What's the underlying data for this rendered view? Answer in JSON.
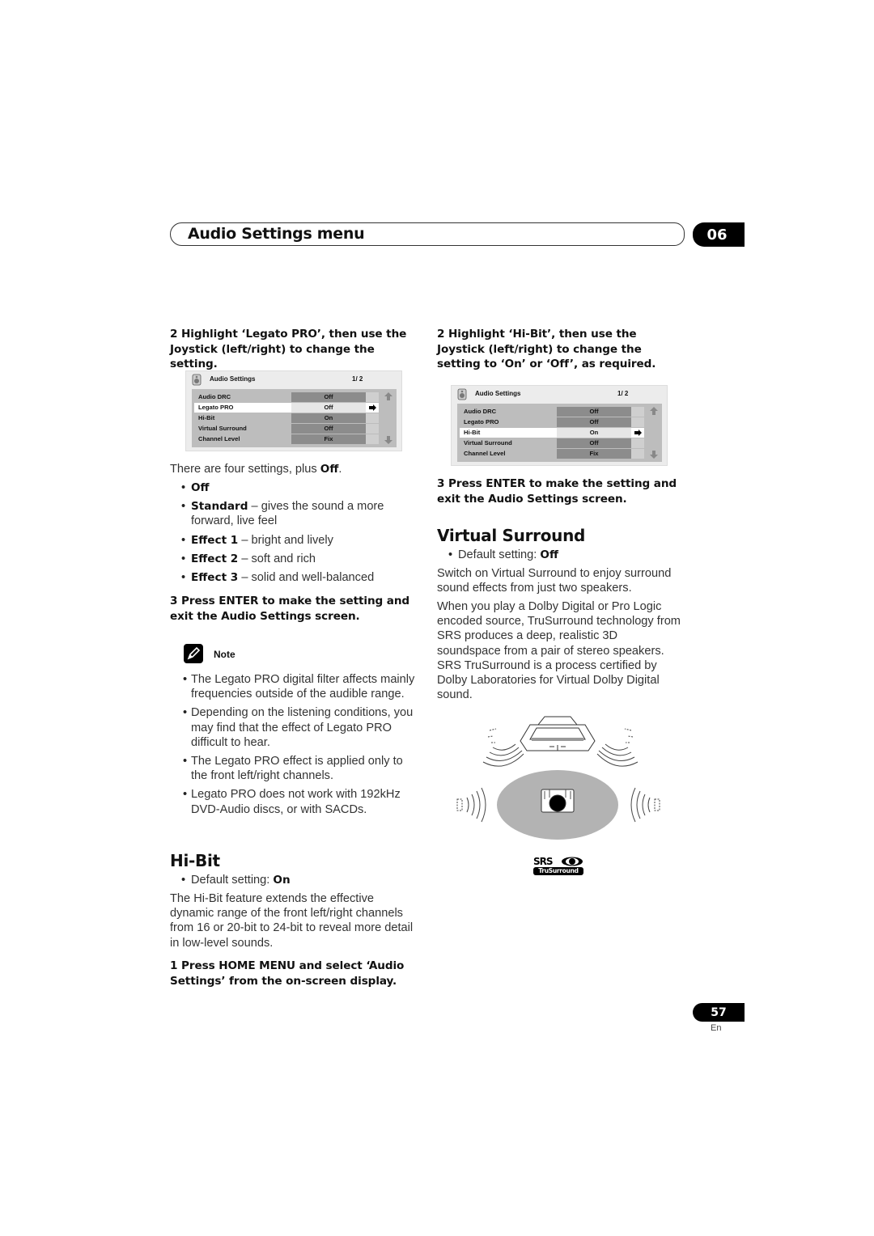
{
  "header": {
    "title": "Audio Settings menu",
    "chapter": "06"
  },
  "left": {
    "step2": "2   Highlight ‘Legato PRO’, then use the Joystick (left/right) to change the setting.",
    "osd": {
      "title": "Audio Settings",
      "page": "1/ 2",
      "selected": "Legato PRO",
      "rows": [
        {
          "label": "Audio DRC",
          "value": "Off"
        },
        {
          "label": "Legato PRO",
          "value": "Off"
        },
        {
          "label": "Hi-Bit",
          "value": "On"
        },
        {
          "label": "Virtual Surround",
          "value": "Off"
        },
        {
          "label": "Channel Level",
          "value": "Fix"
        }
      ]
    },
    "intro_pre": "There are four settings, plus ",
    "intro_bold": "Off",
    "intro_post": ".",
    "settings": [
      {
        "name": "Off",
        "desc": ""
      },
      {
        "name": "Standard",
        "desc": " – gives the sound a more forward, live feel"
      },
      {
        "name": "Effect 1",
        "desc": " – bright and lively"
      },
      {
        "name": "Effect 2",
        "desc": " – soft and rich"
      },
      {
        "name": "Effect 3",
        "desc": " – solid and well-balanced"
      }
    ],
    "step3": "3   Press ENTER to make the setting and exit the Audio Settings screen.",
    "note_label": "Note",
    "notes": [
      "The Legato PRO digital filter affects mainly frequencies outside of the audible range.",
      "Depending on the listening conditions, you may find that the effect of Legato PRO difficult to hear.",
      "The Legato PRO effect is applied only to the front left/right channels.",
      "Legato PRO does not work with 192kHz DVD-Audio discs, or with SACDs."
    ],
    "hibit": {
      "heading": "Hi-Bit",
      "default_label": "Default setting: ",
      "default_value": "On",
      "desc": "The Hi-Bit feature extends the effective dynamic range of the front left/right channels from 16 or 20-bit to 24-bit to reveal more detail in low-level sounds.",
      "step1": "1   Press HOME MENU and select ‘Audio Settings’ from the on-screen display."
    }
  },
  "right": {
    "step2": "2   Highlight ‘Hi-Bit’, then use the Joystick (left/right) to change the setting to ‘On’ or ‘Off’, as required.",
    "osd": {
      "title": "Audio Settings",
      "page": "1/ 2",
      "selected": "Hi-Bit",
      "rows": [
        {
          "label": "Audio DRC",
          "value": "Off"
        },
        {
          "label": "Legato PRO",
          "value": "Off"
        },
        {
          "label": "Hi-Bit",
          "value": "On"
        },
        {
          "label": "Virtual Surround",
          "value": "Off"
        },
        {
          "label": "Channel Level",
          "value": "Fix"
        }
      ]
    },
    "step3": "3   Press ENTER to make the setting and exit the Audio Settings screen.",
    "vs": {
      "heading": "Virtual Surround",
      "default_label": "Default setting: ",
      "default_value": "Off",
      "p1": "Switch on Virtual Surround to enjoy surround sound effects from just two speakers.",
      "p2": "When you play a Dolby Digital or Pro Logic encoded source, TruSurround technology from SRS produces a deep, realistic 3D soundspace from a pair of stereo speakers. SRS TruSurround is a process certified by Dolby Laboratories for Virtual Dolby Digital sound."
    },
    "logo": {
      "top": "SRS",
      "bottom": "TruSurround"
    }
  },
  "footer": {
    "page": "57",
    "lang": "En"
  }
}
